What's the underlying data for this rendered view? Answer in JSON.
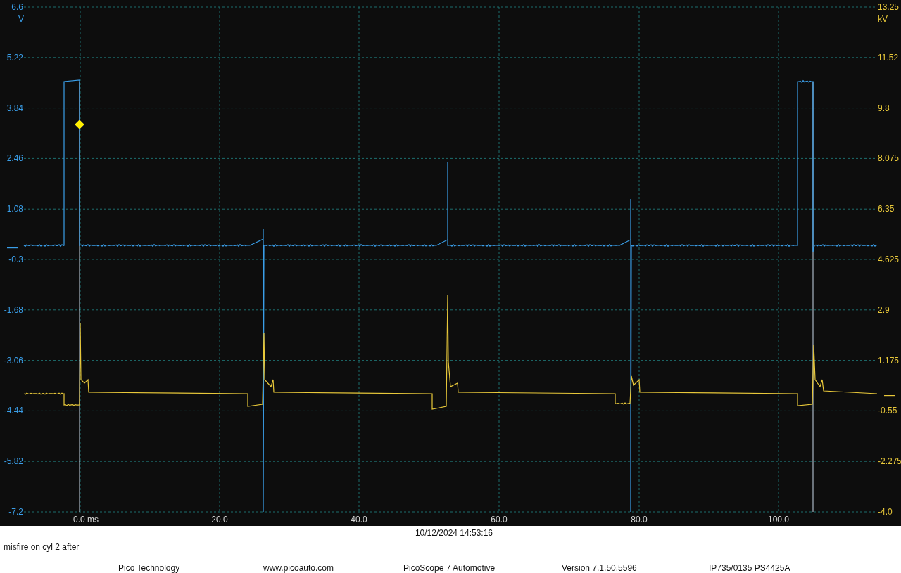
{
  "channels": [
    {
      "unit": "V",
      "color": "#3a9ee8",
      "ticks": [
        "6.6",
        "5.22",
        "3.84",
        "2.46",
        "1.08",
        "-0.3",
        "-1.68",
        "-3.06",
        "-4.44",
        "-5.82",
        "-7.2"
      ]
    },
    {
      "unit": "kV",
      "color": "#e8c83a",
      "ticks": [
        "13.25",
        "11.52",
        "9.8",
        "8.075",
        "6.35",
        "4.625",
        "2.9",
        "1.175",
        "-0.55",
        "-2.275",
        "-4.0"
      ]
    }
  ],
  "time_axis": {
    "ticks": [
      "0.0 ms",
      "20.0",
      "40.0",
      "60.0",
      "80.0",
      "100.0"
    ]
  },
  "timestamp": "10/12/2024 14:53:16",
  "note": "misfire on cyl 2 after",
  "footer": [
    "Pico Technology",
    "www.picoauto.com",
    "PicoScope 7 Automotive",
    "Version 7.1.50.5596",
    "IP735/0135 PS4425A"
  ]
}
